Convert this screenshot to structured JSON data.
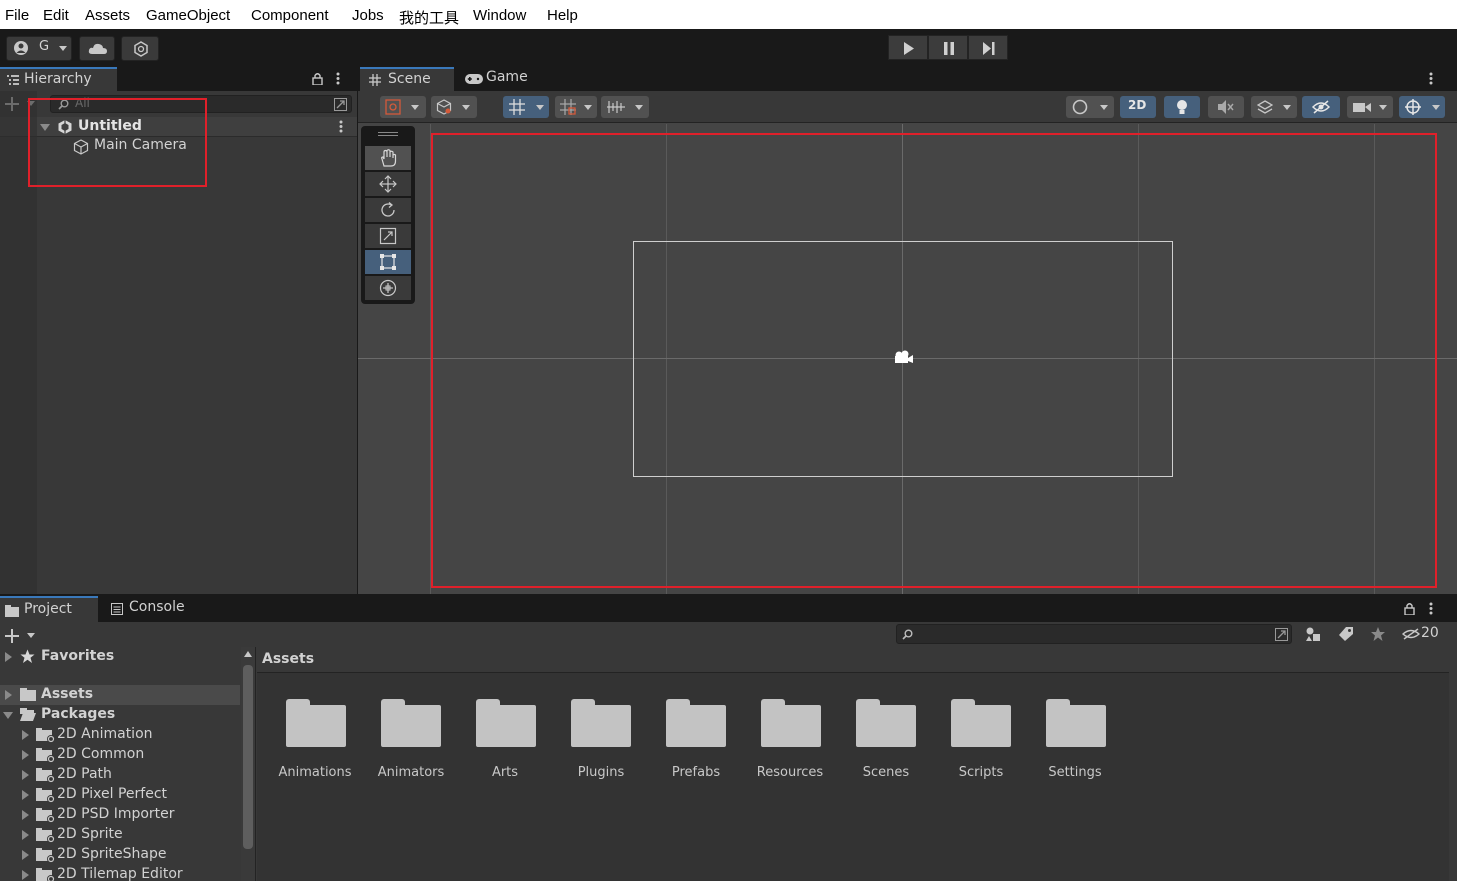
{
  "menubar": [
    "File",
    "Edit",
    "Assets",
    "GameObject",
    "Component",
    "Jobs",
    "我的工具",
    "Window",
    "Help"
  ],
  "toolbar": {
    "account_label": "G"
  },
  "hierarchy": {
    "tab": "Hierarchy",
    "search_placeholder": "All",
    "scene_name": "Untitled",
    "items": [
      "Main Camera"
    ]
  },
  "scene_view": {
    "tabs": [
      "Scene",
      "Game"
    ],
    "mode_2d": "2D"
  },
  "bottom": {
    "tabs": [
      "Project",
      "Console"
    ],
    "hidden_count": "20",
    "tree": {
      "favorites": "Favorites",
      "assets": "Assets",
      "packages": "Packages",
      "package_items": [
        "2D Animation",
        "2D Common",
        "2D Path",
        "2D Pixel Perfect",
        "2D PSD Importer",
        "2D Sprite",
        "2D SpriteShape",
        "2D Tilemap Editor"
      ]
    },
    "breadcrumb": "Assets",
    "folders": [
      "Animations",
      "Animators",
      "Arts",
      "Plugins",
      "Prefabs",
      "Resources",
      "Scenes",
      "Scripts",
      "Settings"
    ]
  }
}
